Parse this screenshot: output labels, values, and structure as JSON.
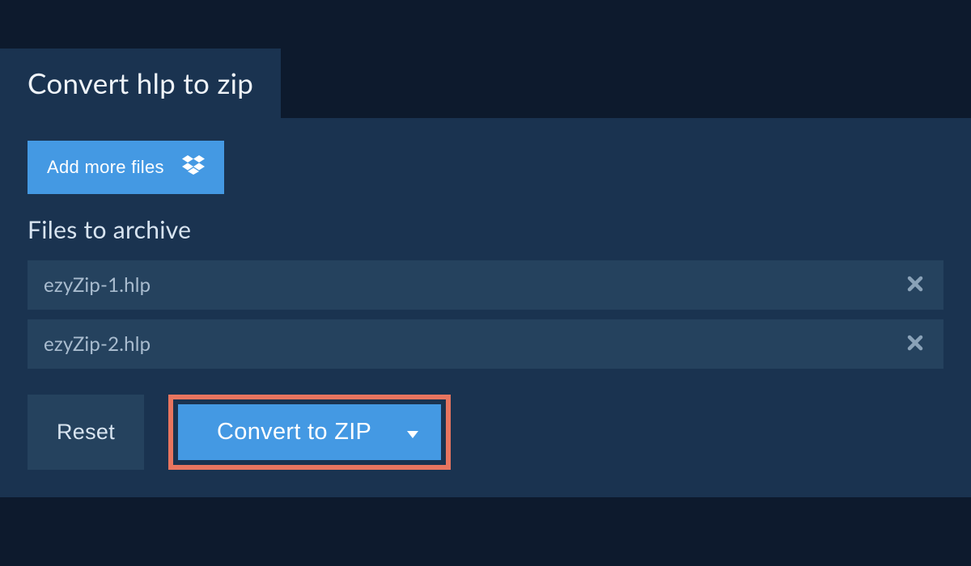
{
  "header": {
    "title": "Convert hlp to zip"
  },
  "actions": {
    "add_more_label": "Add more files",
    "reset_label": "Reset",
    "convert_label": "Convert to ZIP"
  },
  "section": {
    "files_title": "Files to archive"
  },
  "files": [
    {
      "name": "ezyZip-1.hlp"
    },
    {
      "name": "ezyZip-2.hlp"
    }
  ],
  "colors": {
    "accent": "#4499e3",
    "highlight_border": "#e8755f",
    "bg_dark": "#0d1a2d",
    "bg_panel": "#1a3350",
    "bg_row": "#25425e"
  }
}
